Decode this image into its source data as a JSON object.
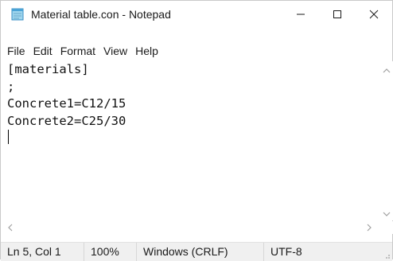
{
  "window": {
    "title": "Material table.con - Notepad",
    "icon": "notepad-icon",
    "controls": {
      "minimize": "minimize-icon",
      "maximize": "maximize-icon",
      "close": "close-icon"
    }
  },
  "menu": {
    "items": [
      {
        "label": "File"
      },
      {
        "label": "Edit"
      },
      {
        "label": "Format"
      },
      {
        "label": "View"
      },
      {
        "label": "Help"
      }
    ]
  },
  "editor": {
    "lines": [
      "[materials]",
      ";",
      "Concrete1=C12/15",
      "Concrete2=C25/30",
      ""
    ]
  },
  "statusbar": {
    "position": "Ln 5, Col 1",
    "zoom": "100%",
    "line_ending": "Windows (CRLF)",
    "encoding": "UTF-8"
  },
  "colors": {
    "status_bg": "#f0f0f0",
    "scroll_arrow": "#a0a0a0"
  }
}
